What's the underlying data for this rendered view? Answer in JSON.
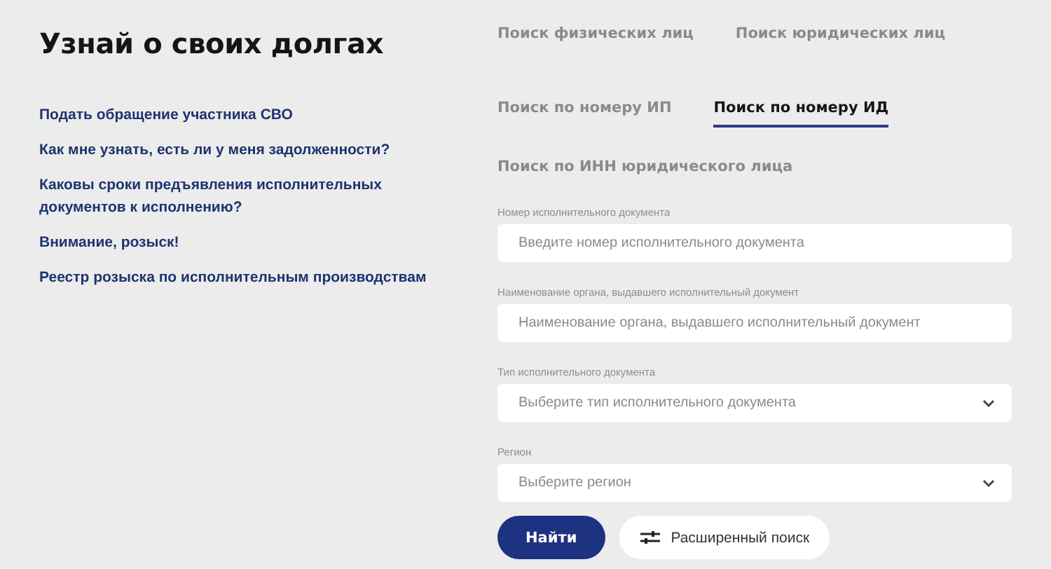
{
  "title": "Узнай о своих долгах",
  "links": [
    "Подать обращение участника СВО",
    "Как мне узнать, есть ли у меня задолженности?",
    "Каковы сроки предъявления исполнительных документов к исполнению?",
    "Внимание, розыск!",
    "Реестр розыска по исполнительным производствам"
  ],
  "person_tabs": [
    {
      "label": "Поиск физических лиц",
      "selected": false
    },
    {
      "label": "Поиск юридических лиц",
      "selected": false
    }
  ],
  "search_tabs": [
    {
      "label": "Поиск по номеру ИП",
      "selected": false
    },
    {
      "label": "Поиск по номеру ИД",
      "selected": true
    },
    {
      "label": "Поиск по ИНН юридического лица",
      "selected": false
    }
  ],
  "fields": [
    {
      "kind": "text",
      "label": "Номер исполнительного документа",
      "placeholder": "Введите номер исполнительного документа"
    },
    {
      "kind": "text",
      "label": "Наименование органа, выдавшего исполнительный документ",
      "placeholder": "Наименование органа, выдавшего исполнительный документ"
    },
    {
      "kind": "select",
      "label": "Тип исполнительного документа",
      "placeholder": "Выберите тип исполнительного документа"
    },
    {
      "kind": "select",
      "label": "Регион",
      "placeholder": "Выберите регион"
    }
  ],
  "buttons": [
    {
      "kind": "primary",
      "label": "Найти"
    },
    {
      "kind": "secondary",
      "label": "Расширенный поиск"
    }
  ]
}
